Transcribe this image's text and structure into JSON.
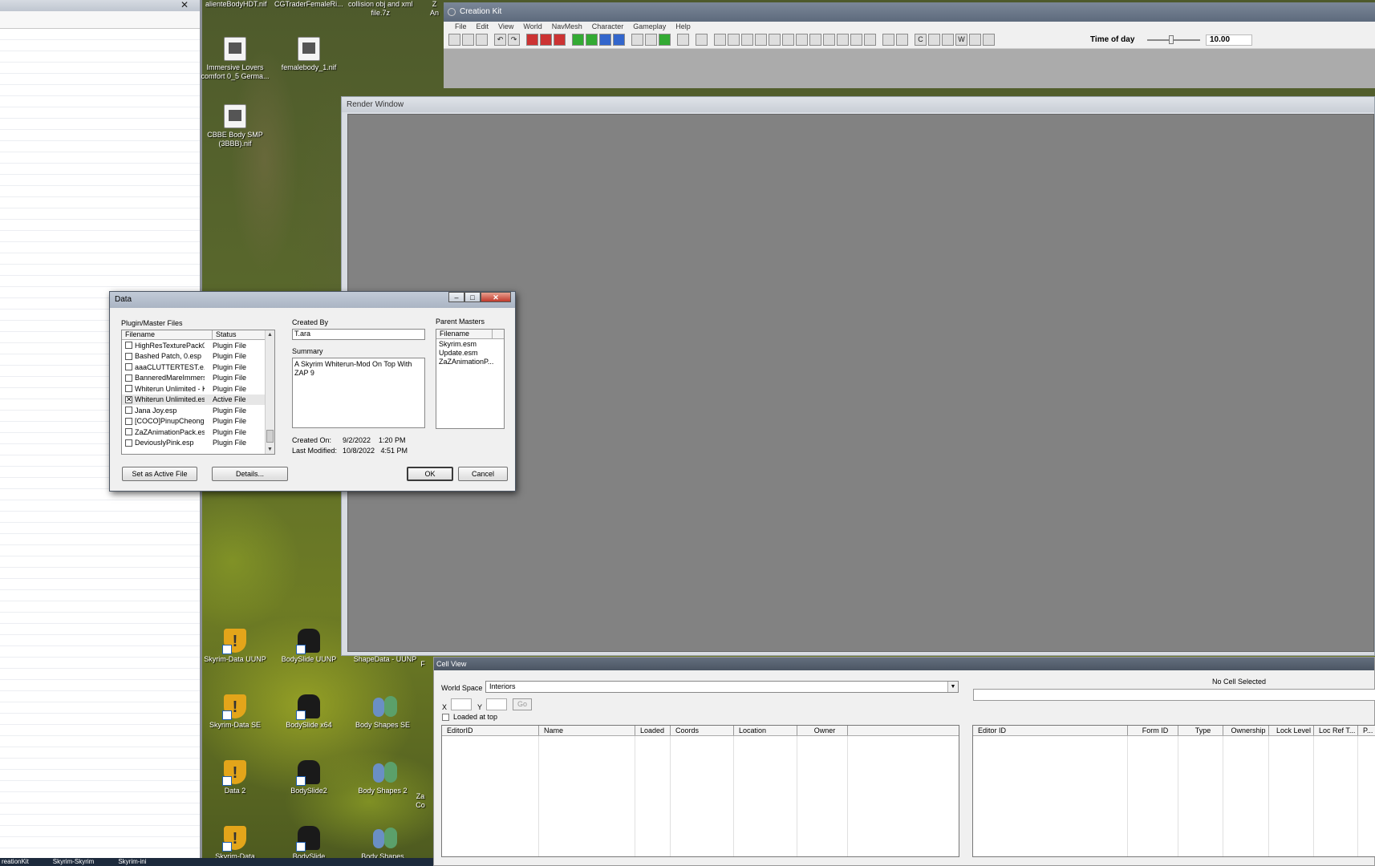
{
  "desktop": {
    "top_labels": [
      "alienteBodyHDT.nif",
      "CGTraderFemaleRi...",
      "collision obj and xml\nfile.7z",
      "Z\nAn"
    ],
    "icons": [
      {
        "label": "Immersive Lovers\ncomfort 0_5 Germa...",
        "icon": "7z-archive-icon"
      },
      {
        "label": "femalebody_1.nif",
        "icon": "nif-file-icon"
      },
      {
        "label": "CBBE Body SMP\n(3BBB).nif",
        "icon": "nif-file-icon"
      },
      {
        "label": "Skyrim-Data UUNP",
        "icon": "shield-shortcut-icon"
      },
      {
        "label": "BodySlide UUNP",
        "icon": "bodyslide-shortcut-icon"
      },
      {
        "label": "ShapeData - UUNP",
        "icon": "folder-icon"
      },
      {
        "label": "Skyrim-Data SE",
        "icon": "shield-shortcut-icon"
      },
      {
        "label": "BodySlide x64",
        "icon": "bodyslide-shortcut-icon"
      },
      {
        "label": "Body Shapes SE",
        "icon": "people-shortcut-icon"
      },
      {
        "label": "Data 2",
        "icon": "shield-shortcut-icon"
      },
      {
        "label": "BodySlide2",
        "icon": "bodyslide-shortcut-icon"
      },
      {
        "label": "Body Shapes 2",
        "icon": "people-shortcut-icon"
      },
      {
        "label": "Skyrim-Data",
        "icon": "shield-shortcut-icon"
      },
      {
        "label": "BodySlide",
        "icon": "bodyslide-shortcut-icon"
      },
      {
        "label": "Body Shapes",
        "icon": "people-shortcut-icon"
      }
    ],
    "side_fragments": [
      "Za\nCo",
      "F"
    ]
  },
  "left_window": {
    "close_glyph": "✕"
  },
  "taskbar": {
    "items": [
      "reationKit",
      "Skyrim-Skyrim",
      "Skyrim-ini"
    ]
  },
  "creation_kit": {
    "title": "Creation Kit",
    "menu": [
      "File",
      "Edit",
      "View",
      "World",
      "NavMesh",
      "Character",
      "Gameplay",
      "Help"
    ],
    "time_of_day_label": "Time of day",
    "time_of_day_value": "10.00",
    "time_of_day_fraction": 0.45
  },
  "render_window": {
    "title": "Render Window"
  },
  "cell_view": {
    "title": "Cell View",
    "world_space_label": "World Space",
    "world_space_value": "Interiors",
    "x_label": "X",
    "y_label": "Y",
    "go_label": "Go",
    "loaded_at_top_label": "Loaded at top",
    "no_cell_label": "No Cell Selected",
    "left_columns": [
      "EditorID",
      "Name",
      "Loaded",
      "Coords",
      "Location",
      "Owner",
      ""
    ],
    "right_columns": [
      "Editor ID",
      "Form ID",
      "Type",
      "Ownership",
      "Lock Level",
      "Loc Ref T...",
      "P..."
    ]
  },
  "data_dialog": {
    "title": "Data",
    "plugin_section_label": "Plugin/Master Files",
    "columns": [
      "Filename",
      "Status"
    ],
    "plugins": [
      {
        "filename": "HighResTexturePack0...",
        "status": "Plugin File",
        "checked": false
      },
      {
        "filename": "Bashed Patch, 0.esp",
        "status": "Plugin File",
        "checked": false
      },
      {
        "filename": "aaaCLUTTERTEST.e...",
        "status": "Plugin File",
        "checked": false
      },
      {
        "filename": "BanneredMareImmersi...",
        "status": "Plugin File",
        "checked": false
      },
      {
        "filename": "Whiterun Unlimited - K...",
        "status": "Plugin File",
        "checked": false
      },
      {
        "filename": "Whiterun Unlimited.esp",
        "status": "Active File",
        "checked": true
      },
      {
        "filename": "Jana Joy.esp",
        "status": "Plugin File",
        "checked": false
      },
      {
        "filename": "[COCO]PinupCheongs...",
        "status": "Plugin File",
        "checked": false
      },
      {
        "filename": "ZaZAnimationPack.esp",
        "status": "Plugin File",
        "checked": false
      },
      {
        "filename": "DeviouslyPink.esp",
        "status": "Plugin File",
        "checked": false
      }
    ],
    "created_by_label": "Created By",
    "created_by_value": "T.ara",
    "summary_label": "Summary",
    "summary_value": "A Skyrim Whiterun-Mod On Top With ZAP 9",
    "parent_masters_label": "Parent Masters",
    "parent_masters_column": "Filename",
    "parent_masters": [
      "Skyrim.esm",
      "Update.esm",
      "ZaZAnimationP..."
    ],
    "created_on_label": "Created On:",
    "created_on_value": "9/2/2022    1:20 PM",
    "last_modified_label": "Last Modified:",
    "last_modified_value": "10/8/2022   4:51 PM",
    "buttons": {
      "set_active": "Set as Active File",
      "details": "Details...",
      "ok": "OK",
      "cancel": "Cancel"
    }
  }
}
